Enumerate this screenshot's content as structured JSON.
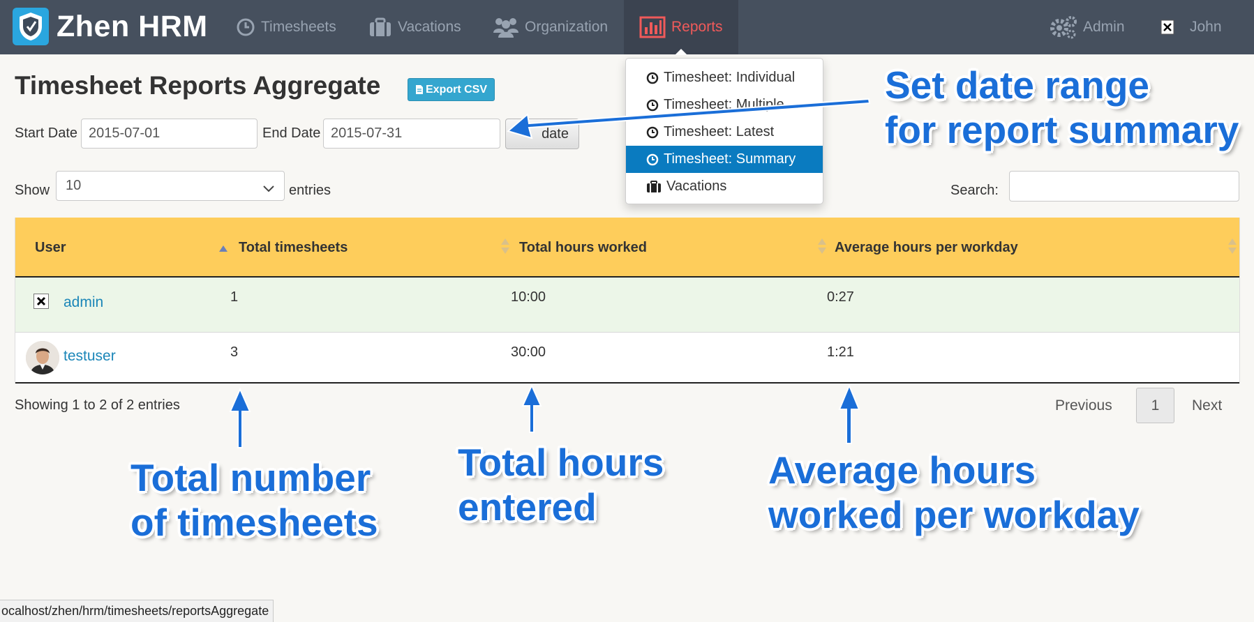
{
  "nav": {
    "brand": "Zhen HRM",
    "items": [
      {
        "label": "Timesheets",
        "icon": "clock-icon"
      },
      {
        "label": "Vacations",
        "icon": "briefcase-icon"
      },
      {
        "label": "Organization",
        "icon": "users-icon"
      },
      {
        "label": "Reports",
        "icon": "bar-chart-icon"
      },
      {
        "label": "Admin",
        "icon": "gears-icon"
      },
      {
        "label": "John",
        "icon": "broken-image-icon"
      }
    ],
    "active_color": "#f05a5a"
  },
  "reports_menu": {
    "items": [
      {
        "label": "Timesheet: Individual"
      },
      {
        "label": "Timesheet: Multiple"
      },
      {
        "label": "Timesheet: Latest"
      },
      {
        "label": "Timesheet: Summary"
      },
      {
        "label": "Vacations"
      }
    ],
    "active_item": "Timesheet: Summary",
    "highlight_color": "#0a7bc0"
  },
  "page": {
    "title": "Timesheet Reports Aggregate",
    "export_label": "Export CSV",
    "start_date_label": "Start Date",
    "start_date_value": "2015-07-01",
    "end_date_label": "End Date",
    "end_date_value": "2015-07-31",
    "update_label": "date",
    "show_label": "Show",
    "entries_value": "10",
    "entries_label": "entries",
    "search_label": "Search:",
    "search_value": ""
  },
  "table": {
    "header_color": "#fecd5b",
    "columns": [
      "User",
      "Total timesheets",
      "Total hours worked",
      "Average hours per workday"
    ],
    "rows": [
      {
        "user": "admin",
        "total_timesheets": "1",
        "total_hours": "10:00",
        "avg_hours": "0:27"
      },
      {
        "user": "testuser",
        "total_timesheets": "3",
        "total_hours": "30:00",
        "avg_hours": "1:21"
      }
    ],
    "info": "Showing 1 to 2 of 2 entries",
    "pagination": {
      "previous": "Previous",
      "current": "1",
      "next": "Next"
    }
  },
  "statusbar": "ocalhost/zhen/hrm/timesheets/reportsAggregate",
  "annotations": {
    "color": "#1a6ed8",
    "date_range": [
      "Set date range",
      "for report summary"
    ],
    "total_timesheets": [
      "Total number",
      "of timesheets"
    ],
    "total_hours": [
      "Total hours",
      "entered"
    ],
    "avg_hours": [
      "Average hours",
      "worked per workday"
    ]
  }
}
